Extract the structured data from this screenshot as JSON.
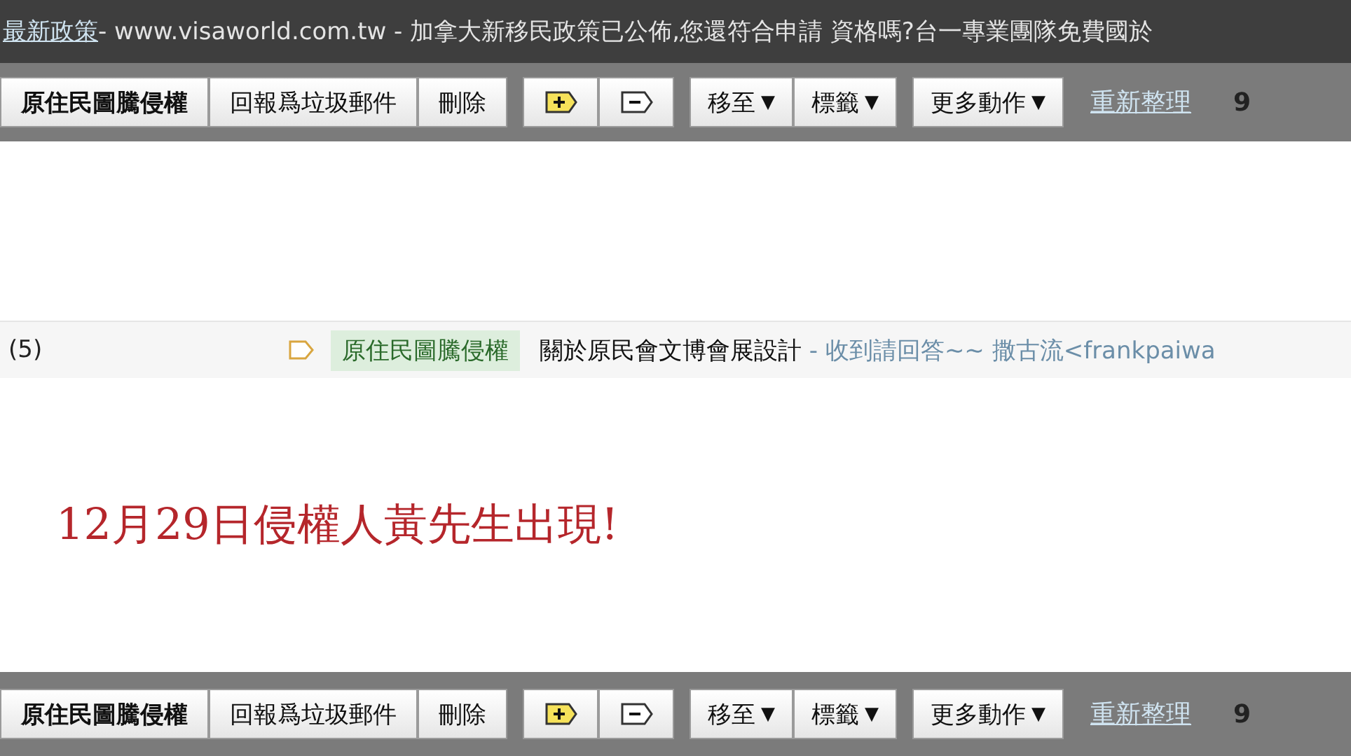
{
  "ad_bar": {
    "link": "最新政策",
    "text": " - www.visaworld.com.tw - 加拿大新移民政策已公佈,您還符合申請 資格嗎?台一專業團隊免費國於"
  },
  "toolbars": [
    {
      "buttons": [
        {
          "kind": "text",
          "label": "原住民圖騰侵權",
          "bold": true
        },
        {
          "kind": "text",
          "label": "回報爲垃圾郵件",
          "bold": false
        },
        {
          "kind": "text",
          "label": "刪除",
          "bold": false
        },
        {
          "kind": "add-label"
        },
        {
          "kind": "remove-label"
        },
        {
          "kind": "menu",
          "label": "移至",
          "caret": "▼"
        },
        {
          "kind": "menu",
          "label": "標籤",
          "caret": "▼"
        },
        {
          "kind": "menu",
          "label": "更多動作",
          "caret": "▼"
        }
      ],
      "refresh": "重新整理",
      "count": "9"
    },
    {
      "buttons": [
        {
          "kind": "text",
          "label": "原住民圖騰侵權",
          "bold": true
        },
        {
          "kind": "text",
          "label": "回報爲垃圾郵件",
          "bold": false
        },
        {
          "kind": "text",
          "label": "刪除",
          "bold": false
        },
        {
          "kind": "add-label"
        },
        {
          "kind": "remove-label"
        },
        {
          "kind": "menu",
          "label": "移至",
          "caret": "▼"
        },
        {
          "kind": "menu",
          "label": "標籤",
          "caret": "▼"
        },
        {
          "kind": "menu",
          "label": "更多動作",
          "caret": "▼"
        }
      ],
      "refresh": "重新整理",
      "count": "9"
    }
  ],
  "thread_row": {
    "count": "(5)",
    "label": "原住民圖騰侵權",
    "subject": "關於原民會文博會展設計",
    "snippet": " - 收到請回答~~ 撒古流<frankpaiwa"
  },
  "message": {
    "text": "12月29日侵權人黃先生出現!"
  }
}
